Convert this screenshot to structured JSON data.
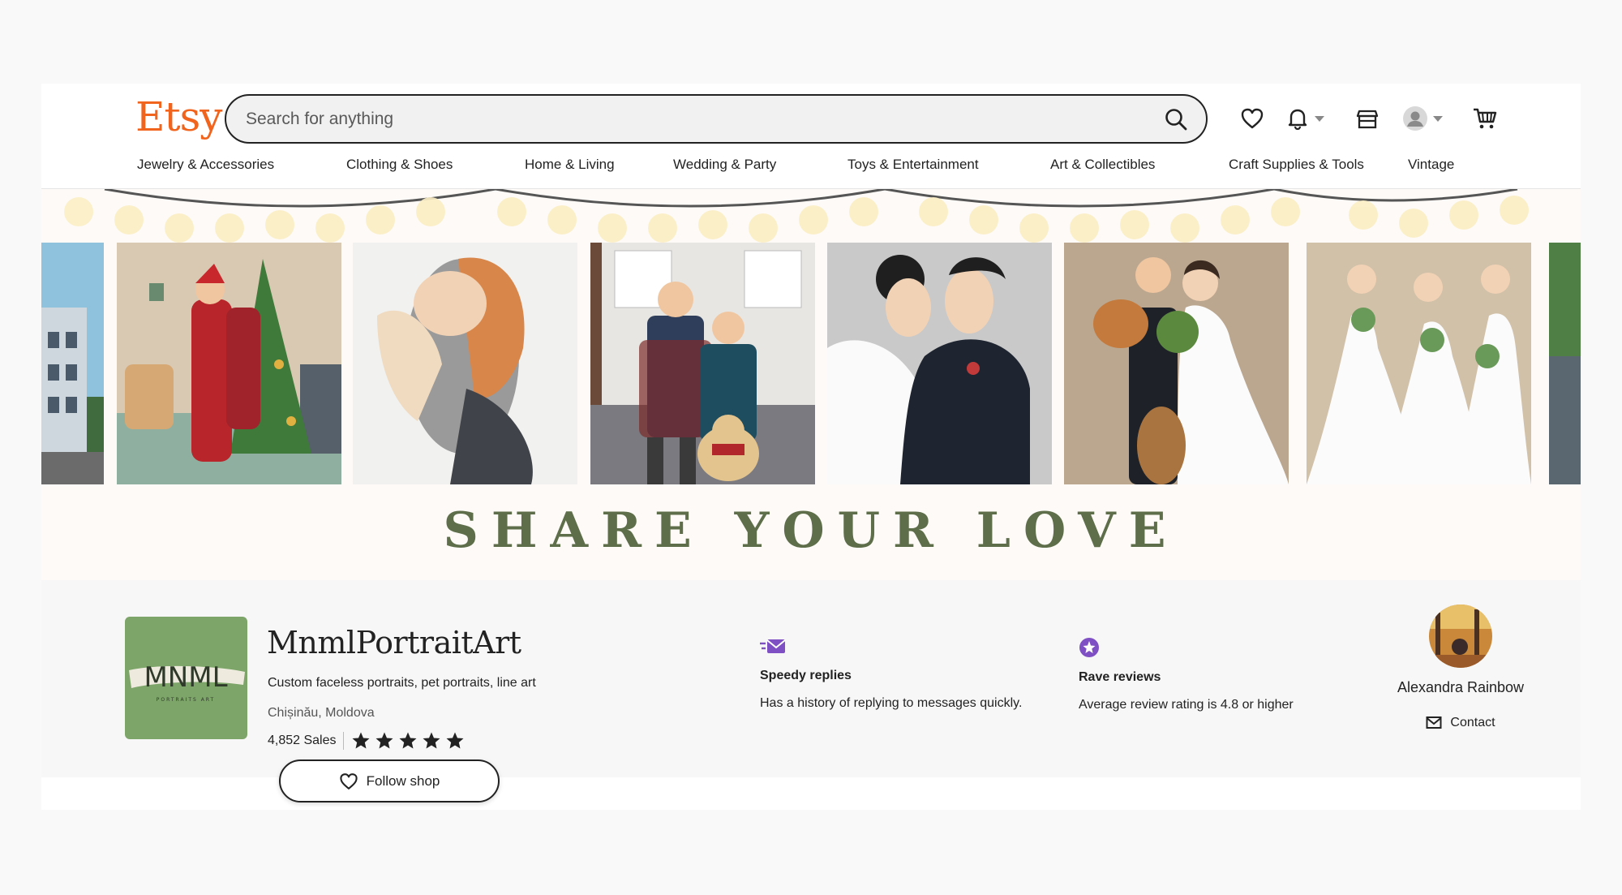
{
  "brand": {
    "logo": "Etsy",
    "accent": "#f1641e"
  },
  "search": {
    "placeholder": "Search for anything",
    "icon": "search-icon"
  },
  "header_icons": [
    "heart-icon",
    "bell-icon",
    "shop-icon",
    "account-icon",
    "cart-icon"
  ],
  "categories": [
    "Jewelry & Accessories",
    "Clothing & Shoes",
    "Home & Living",
    "Wedding & Party",
    "Toys & Entertainment",
    "Art & Collectibles",
    "Craft Supplies & Tools",
    "Vintage"
  ],
  "banner": {
    "title": "SHARE YOUR LOVE",
    "title_color": "#5f6e4a"
  },
  "shop": {
    "logo_text": "MNML",
    "logo_subtext": "PORTRAITS ART",
    "name": "MnmlPortraitArt",
    "description": "Custom faceless portraits, pet portraits, line art",
    "location": "Chișinău, Moldova",
    "sales": "4,852 Sales",
    "rating_stars": 5,
    "follow_label": "Follow shop"
  },
  "features": [
    {
      "icon": "speedy-replies-icon",
      "title": "Speedy replies",
      "desc": "Has a history of replying to messages quickly."
    },
    {
      "icon": "rave-reviews-icon",
      "title": "Rave reviews",
      "desc": "Average review rating is 4.8 or higher"
    }
  ],
  "owner": {
    "name": "Alexandra Rainbow",
    "contact_label": "Contact"
  }
}
